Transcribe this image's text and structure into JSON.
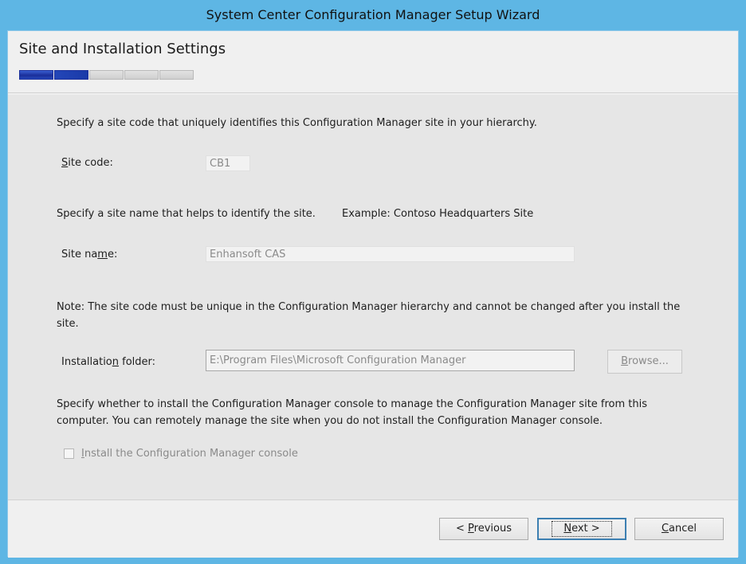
{
  "window": {
    "title": "System Center Configuration Manager Setup Wizard"
  },
  "header": {
    "page_title": "Site and Installation Settings",
    "progress": {
      "total_steps": 5,
      "completed_steps": 1.5
    }
  },
  "site_code": {
    "intro": "Specify a site code that uniquely identifies this Configuration Manager site in your hierarchy.",
    "label_pre": "",
    "label_access": "S",
    "label_post": "ite code:",
    "value": "CB1"
  },
  "site_name": {
    "intro": "Specify a site name that helps to identify the site.",
    "example": "Example: Contoso Headquarters Site",
    "label_pre": "Site na",
    "label_access": "m",
    "label_post": "e:",
    "value": "Enhansoft CAS"
  },
  "install_folder": {
    "note": "Note: The site code must be unique in the Configuration Manager hierarchy and cannot be changed after you install the site.",
    "label_pre": "Installatio",
    "label_access": "n",
    "label_post": " folder:",
    "value": "E:\\Program Files\\Microsoft Configuration Manager",
    "browse_pre": "",
    "browse_access": "B",
    "browse_post": "rowse..."
  },
  "console": {
    "description": "Specify whether to install the Configuration Manager console to manage the Configuration Manager site from this computer. You can remotely manage the site when you do not install the Configuration Manager console.",
    "checkbox_pre": "",
    "checkbox_access": "I",
    "checkbox_post": "nstall the Configuration Manager console",
    "checked": false
  },
  "footer": {
    "previous_pre": "< ",
    "previous_access": "P",
    "previous_post": "revious",
    "next_pre": "",
    "next_access": "N",
    "next_post": "ext >",
    "cancel_pre": "",
    "cancel_access": "C",
    "cancel_post": "ancel"
  },
  "colors": {
    "window_frame": "#5eb6e4",
    "progress_fill": "#1b2f9a"
  }
}
